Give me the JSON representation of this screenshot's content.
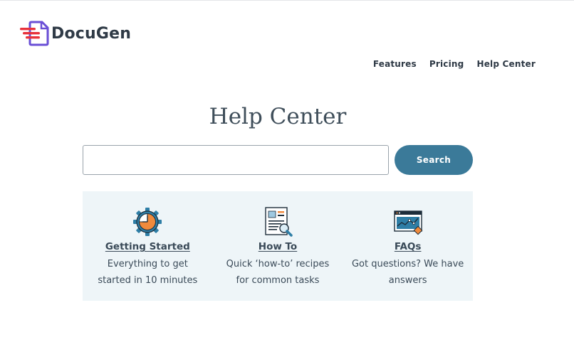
{
  "brand": {
    "name": "DocuGen",
    "colors": {
      "purple": "#6a4fd6",
      "red": "#e8323c"
    }
  },
  "nav": {
    "items": [
      "Features",
      "Pricing",
      "Help Center"
    ]
  },
  "page": {
    "title": "Help Center"
  },
  "search": {
    "placeholder": "",
    "button_label": "Search",
    "accent": "#3b7a99"
  },
  "categories": [
    {
      "icon": "gear-clock-icon",
      "title": "Getting Started",
      "desc": "Everything to get started in 10 minutes"
    },
    {
      "icon": "document-magnifier-icon",
      "title": "How To",
      "desc": "Quick ‘how-to’ recipes for common tasks"
    },
    {
      "icon": "chart-browser-icon",
      "title": "FAQs",
      "desc": "Got questions? We have answers"
    }
  ]
}
